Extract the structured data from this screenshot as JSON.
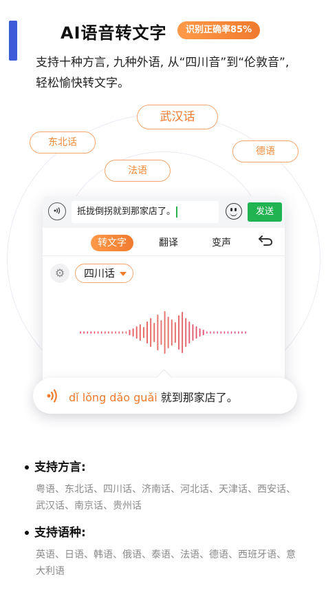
{
  "header": {
    "title": "AI语音转文字",
    "badge": "识别正确率85%"
  },
  "description": "支持十种方言, 九种外语, 从“四川音”到“伦敦音”, 轻松愉快转文字。",
  "floating_tags": [
    "武汉话",
    "东北话",
    "德语",
    "法语"
  ],
  "panel": {
    "input_text": "抵拢倒拐就到那家店了。",
    "send_label": "发送",
    "tabs": [
      "转文字",
      "翻译",
      "变声"
    ],
    "dialect_selected": "四川话"
  },
  "result": {
    "pinyin": "dǐ lǒng dǎo guǎi",
    "text": " 就到那家店了。"
  },
  "sections": [
    {
      "title": "支持方言:",
      "body": "粤语、东北话、四川话、济南话、河北话、天津话、西安话、武汉话、南京话、贵州话"
    },
    {
      "title": "支持语种:",
      "body": "英语、日语、韩语、俄语、泰语、法语、德语、西班牙语、意大利语"
    }
  ],
  "colors": {
    "accent": "#f07a2d",
    "send": "#21b252",
    "side": "#3b5bd9"
  },
  "icons": [
    "sound-wave-icon",
    "emoji-icon",
    "undo-icon",
    "gear-icon",
    "chevron-down-icon",
    "speaker-icon"
  ]
}
